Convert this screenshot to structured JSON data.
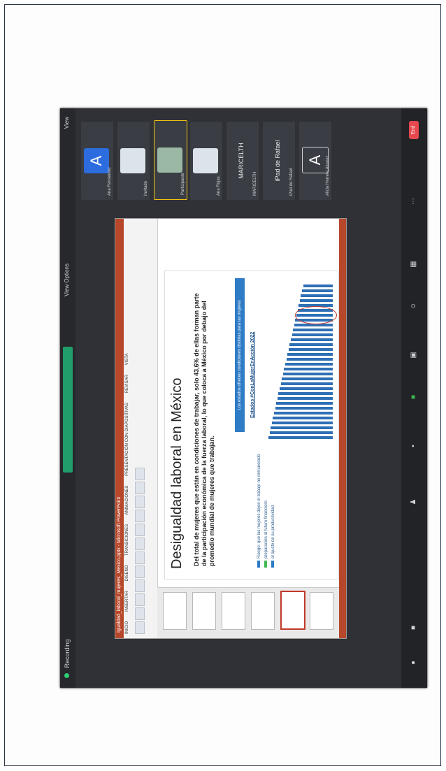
{
  "meeting": {
    "recording_label": "Recording",
    "speaking_banner": "",
    "view_label": "View Options",
    "gallery_label": "View"
  },
  "powerpoint": {
    "window_title": "Igualdad_laboral_mujeres_Mexico.pptx - Microsoft PowerPoint",
    "tabs": [
      "INICIO",
      "INSERTAR",
      "DISEÑO",
      "TRANSICIONES",
      "ANIMACIONES",
      "PRESENTACIÓN CON DIAPOSITIVAS",
      "REVISAR",
      "VISTA"
    ],
    "slide_title": "Desigualdad laboral en México",
    "slide_body": "Del total de mujeres que están en condiciones de trabajar, solo 43,6% de ellas forman parte de la participación económica de la fuerza laboral, lo que coloca a México por debajo del promedio mundial de mujeres que trabajan.",
    "banner": "Los estados ofrecen condiciones distintas para las mujeres",
    "chart_title": "Estados #ConLaMujerEnAcción 2022",
    "legend": [
      "Riesgo: que las mujeres dejen el trabajo no remunerado",
      "preparación al futuro financiero",
      "el ajuste de su productividad"
    ]
  },
  "participants": [
    {
      "initial": "A",
      "name": "Ana Fernández"
    },
    {
      "initial": "",
      "name": "Invitado"
    },
    {
      "initial": "",
      "name": "Participante"
    },
    {
      "initial": "",
      "name": "Ana Rojas"
    },
    {
      "initial": "",
      "bigname": "MARICELTH",
      "name": "MARICELTH"
    },
    {
      "initial": "",
      "bigname": "iPad de Rafael",
      "name": "iPad de Rafael"
    },
    {
      "initial": "A",
      "name": "Alicia Herrera Alvarez"
    }
  ],
  "controls": {
    "end_label": "End"
  }
}
